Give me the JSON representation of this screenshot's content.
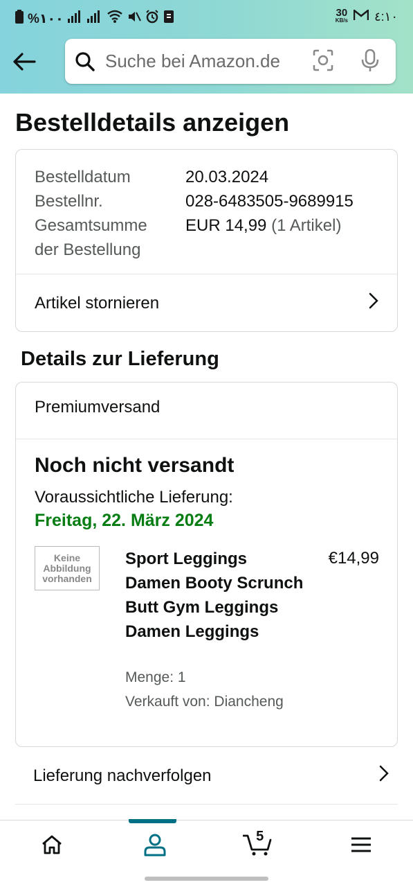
{
  "status_bar": {
    "battery_text": "%١٠٠",
    "net_speed_value": "30",
    "net_speed_unit": "KB/s",
    "clock": "٤:١٠"
  },
  "header": {
    "search_placeholder": "Suche bei Amazon.de"
  },
  "page_title": "Bestelldetails anzeigen",
  "order_summary": {
    "rows": [
      {
        "label": "Bestelldatum",
        "value": "20.03.2024"
      },
      {
        "label": "Bestellnr.",
        "value": "028-6483505-9689915"
      }
    ],
    "total_label_line1": "Gesamtsumme",
    "total_label_line2": "der Bestellung",
    "total_value": "EUR 14,99",
    "total_items": "(1 Artikel)",
    "cancel_label": "Artikel stornieren"
  },
  "delivery": {
    "section_title": "Details zur Lieferung",
    "shipping_type": "Premiumversand",
    "status": "Noch nicht versandt",
    "eta_label": "Voraussichtliche Lieferung:",
    "eta_date": "Freitag, 22. März 2024",
    "eta_color": "#067d12"
  },
  "item": {
    "no_image_line1": "Keine",
    "no_image_line2": "Abbildung",
    "no_image_line3": "vorhanden",
    "title": "Sport Leggings Damen Booty Scrunch Butt Gym Leggings Damen Leggings",
    "price": "€14,99",
    "quantity": "Menge: 1",
    "seller": "Verkauft von: Diancheng"
  },
  "track_label": "Lieferung nachverfolgen",
  "bottom_nav": {
    "active": "account",
    "cart_count": "5",
    "accent": "#007185"
  }
}
